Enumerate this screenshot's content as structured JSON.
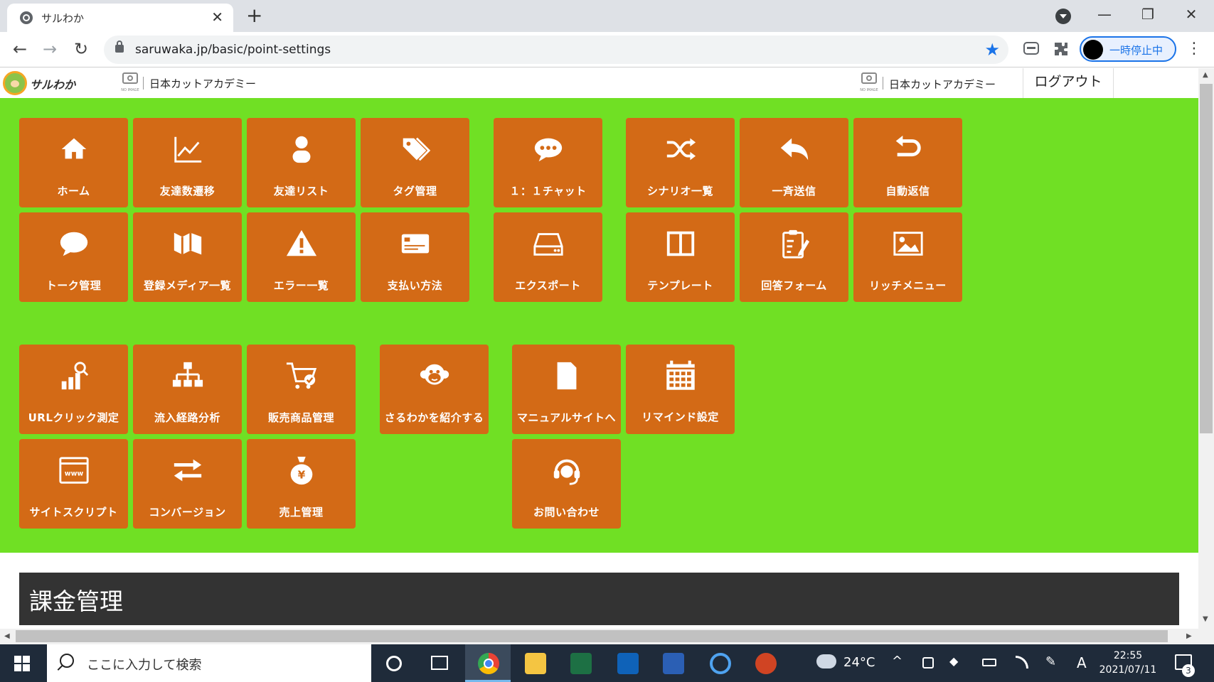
{
  "browser": {
    "tab_title": "サルわか",
    "tab_close": "✕",
    "new_tab": "+",
    "url": "saruwaka.jp/basic/point-settings",
    "profile_status": "一時停止中",
    "win_minimize": "—",
    "win_restore": "❐",
    "win_close": "✕",
    "back": "←",
    "forward": "→",
    "reload": "↻",
    "star": "★",
    "kebab": "⋮"
  },
  "header": {
    "logo_text": "サルわか",
    "noimage_text": "NO IMAGE",
    "account_name_left": "日本カットアカデミー",
    "account_name_right": "日本カットアカデミー",
    "logout_label": "ログアウト"
  },
  "menu": {
    "home": "ホーム",
    "friend_trend": "友達数遷移",
    "friend_list": "友達リスト",
    "tag_manage": "タグ管理",
    "chat": "１：１チャット",
    "scenario_list": "シナリオ一覧",
    "broadcast": "一斉送信",
    "auto_reply": "自動返信",
    "talk_manage": "トーク管理",
    "media_list": "登録メディア一覧",
    "error_list": "エラー一覧",
    "payment": "支払い方法",
    "export": "エクスポート",
    "template": "テンプレート",
    "answer_form": "回答フォーム",
    "rich_menu": "リッチメニュー",
    "url_click": "URLクリック測定",
    "inflow": "流入経路分析",
    "products": "販売商品管理",
    "introduce": "さるわかを紹介する",
    "manual": "マニュアルサイトへ",
    "remind": "リマインド設定",
    "site_script": "サイトスクリプト",
    "conversion": "コンバージョン",
    "sales": "売上管理",
    "contact": "お問い合わせ"
  },
  "section": {
    "title": "課金管理"
  },
  "taskbar": {
    "search_placeholder": "ここに入力して検索",
    "weather": "24°C",
    "ime": "A",
    "time": "22:55",
    "date": "2021/07/11",
    "notification_count": "3"
  },
  "colors": {
    "menu_bg": "#70e024",
    "tile_bg": "#d36a16",
    "section_bg": "#333333",
    "accent_blue": "#1a73e8"
  }
}
